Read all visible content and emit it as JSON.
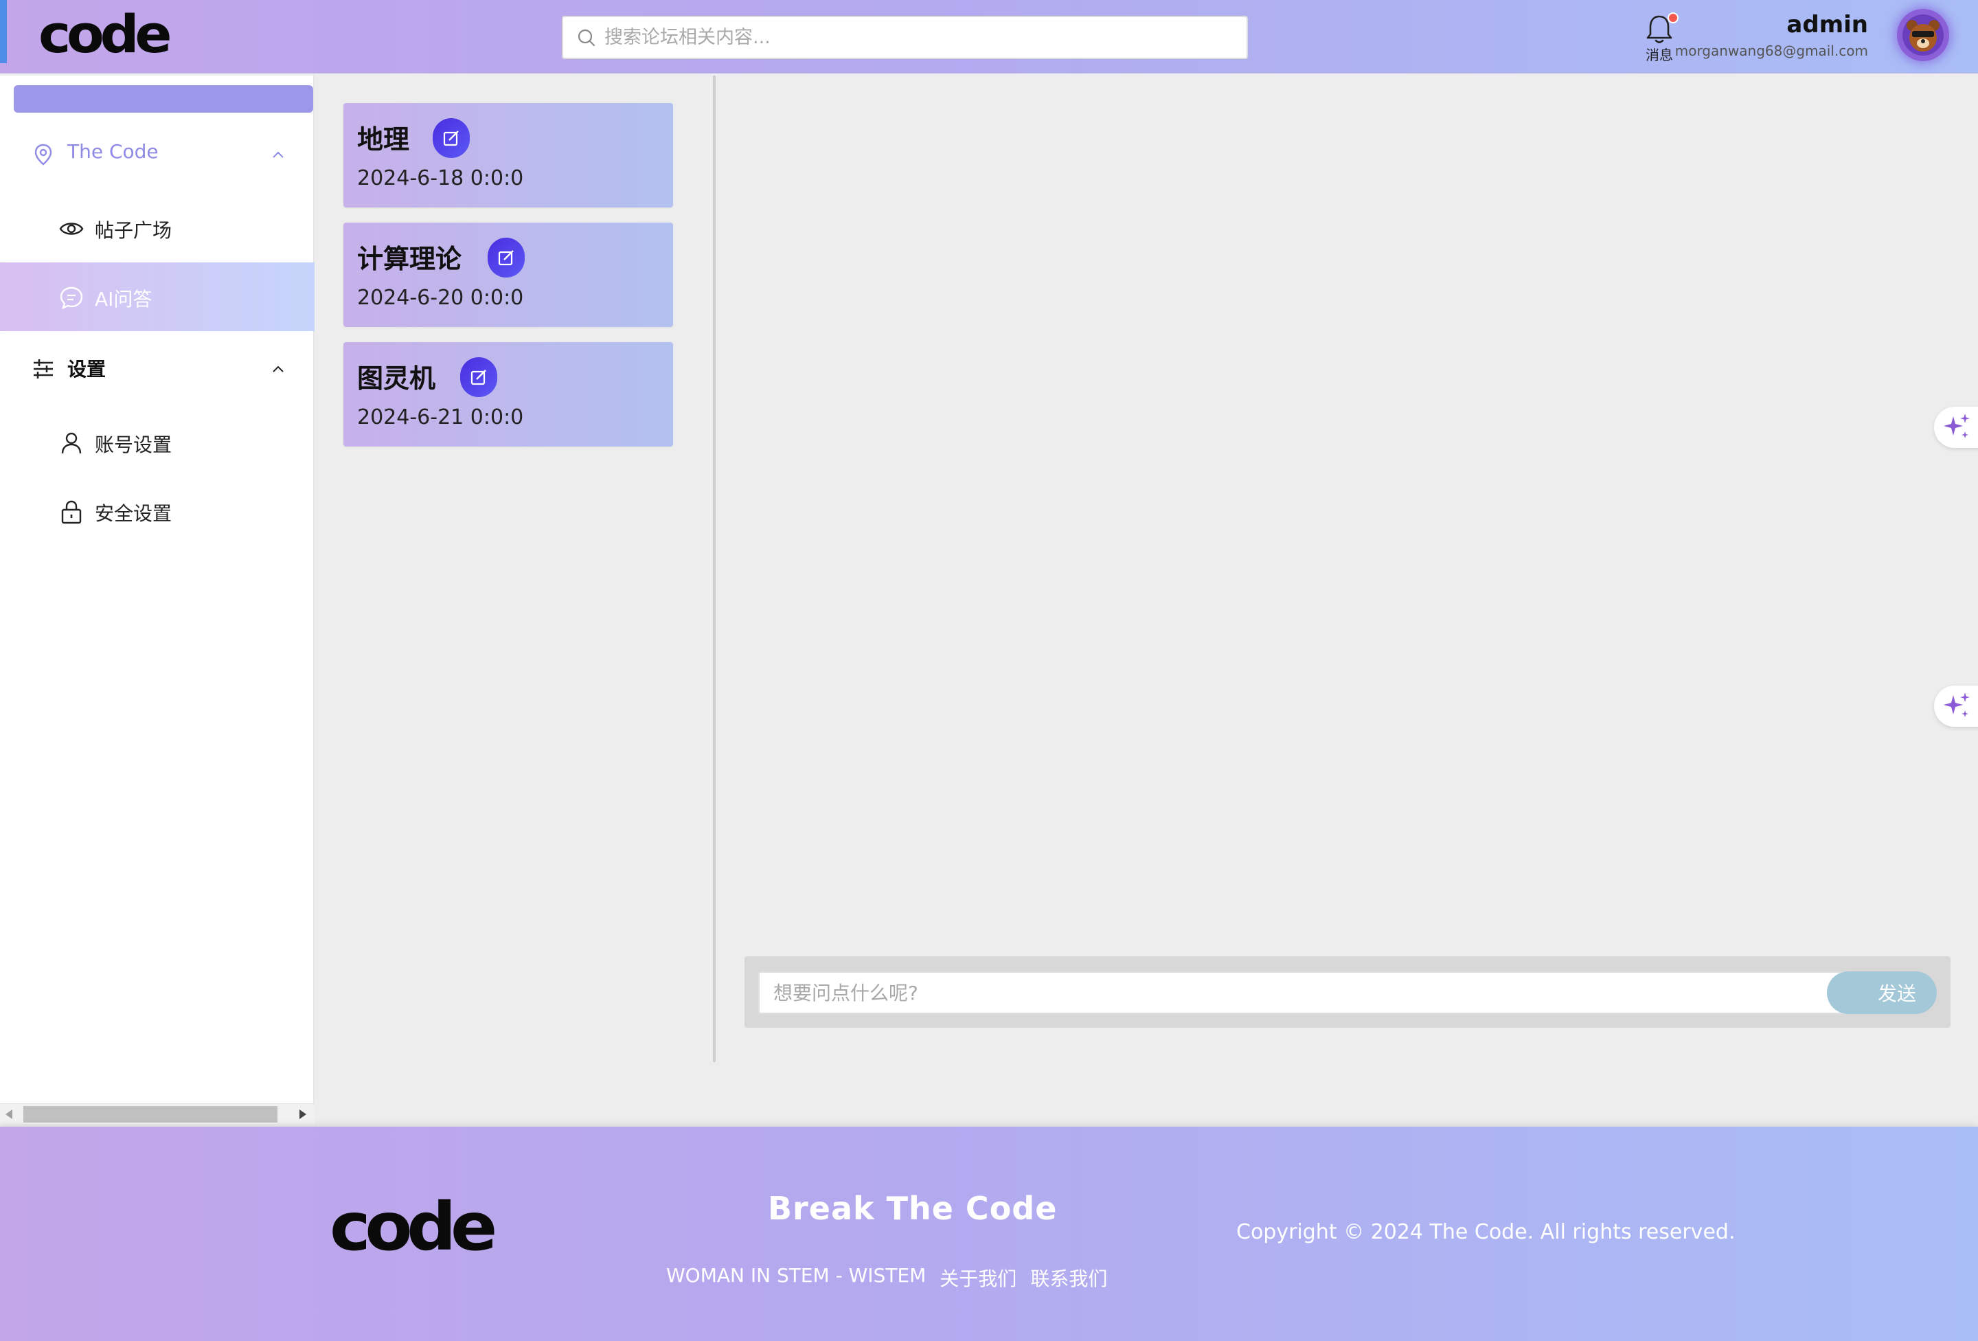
{
  "header": {
    "logo": "code",
    "search_placeholder": "搜索论坛相关内容...",
    "notifications_label": "消息",
    "user_name": "admin",
    "user_email": "morganwang68@gmail.com",
    "avatar_icon": "bear-avatar-icon"
  },
  "sidebar": {
    "group_main": {
      "label": "The Code",
      "icon": "location-pin-icon",
      "color": "#8e8ae6"
    },
    "items_main": [
      {
        "label": "帖子广场",
        "icon": "eye-icon"
      },
      {
        "label": "AI问答",
        "icon": "chat-bubble-icon",
        "active": true
      }
    ],
    "group_settings": {
      "label": "设置",
      "icon": "sliders-icon"
    },
    "items_settings": [
      {
        "label": "账号设置",
        "icon": "user-icon"
      },
      {
        "label": "安全设置",
        "icon": "lock-icon"
      }
    ]
  },
  "conversations": [
    {
      "title": "地理",
      "date": "2024-6-18 0:0:0"
    },
    {
      "title": "计算理论",
      "date": "2024-6-20 0:0:0"
    },
    {
      "title": "图灵机",
      "date": "2024-6-21 0:0:0"
    }
  ],
  "chat": {
    "input_placeholder": "想要问点什么呢?",
    "send_label": "发送"
  },
  "footer": {
    "logo": "code",
    "tagline": "Break The Code",
    "links": [
      "WOMAN IN STEM - WISTEM",
      "关于我们",
      "联系我们"
    ],
    "copyright": "Copyright © 2024 The Code. All rights reserved."
  },
  "colors": {
    "accent": "#8e8ae6",
    "edit_button": "#4a2ee0",
    "send_button": "#a3c8d8",
    "notification_dot": "#f4574e"
  }
}
